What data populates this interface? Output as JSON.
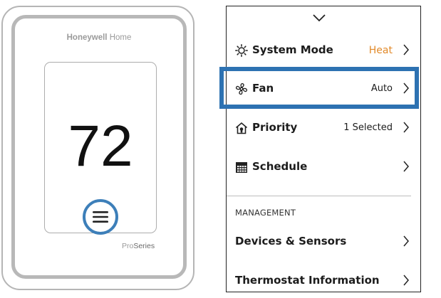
{
  "device": {
    "brand_bold": "Honeywell",
    "brand_light": "Home",
    "temperature": "72",
    "series_prefix": "Pro",
    "series_suffix": "Series",
    "menu_icon": "hamburger-menu-icon"
  },
  "menu": {
    "top_icon": "chevron-down-icon",
    "items": [
      {
        "icon": "sun-icon",
        "label": "System Mode",
        "value": "Heat"
      },
      {
        "icon": "fan-icon",
        "label": "Fan",
        "value": "Auto"
      },
      {
        "icon": "house-priority-icon",
        "label": "Priority",
        "value": "1 Selected"
      },
      {
        "icon": "calendar-icon",
        "label": "Schedule",
        "value": ""
      }
    ],
    "section_title": "MANAGEMENT",
    "management_items": [
      {
        "label": "Devices & Sensors"
      },
      {
        "label": "Thermostat Information"
      }
    ]
  },
  "colors": {
    "highlight": "#2d72b2",
    "heat": "#e28a2a"
  }
}
